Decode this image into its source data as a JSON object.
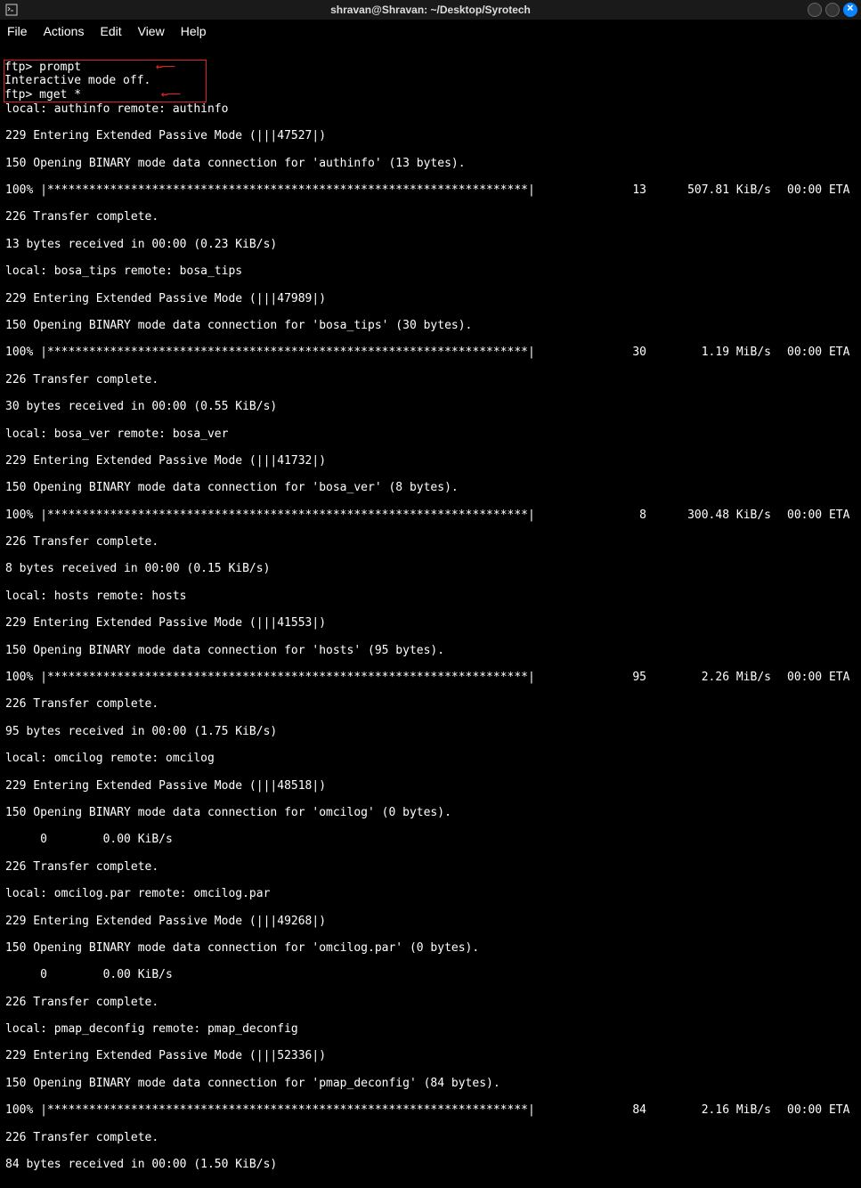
{
  "window": {
    "title": "shravan@Shravan: ~/Desktop/Syrotech"
  },
  "menu": {
    "file": "File",
    "actions": "Actions",
    "edit": "Edit",
    "view": "View",
    "help": "Help"
  },
  "box": {
    "line1": "ftp> prompt",
    "line2": "Interactive mode off.",
    "line3": "ftp> mget *"
  },
  "lines": {
    "l0": "local: authinfo remote: authinfo",
    "l1": "229 Entering Extended Passive Mode (|||47527|)",
    "l2": "150 Opening BINARY mode data connection for 'authinfo' (13 bytes).",
    "l3a": "100% |*********************************************************************|",
    "l3b": "13",
    "l3c": "507.81 KiB/s",
    "l3d": "00:00 ETA",
    "l4": "226 Transfer complete.",
    "l5": "13 bytes received in 00:00 (0.23 KiB/s)",
    "l6": "local: bosa_tips remote: bosa_tips",
    "l7": "229 Entering Extended Passive Mode (|||47989|)",
    "l8": "150 Opening BINARY mode data connection for 'bosa_tips' (30 bytes).",
    "l9a": "100% |*********************************************************************|",
    "l9b": "30",
    "l9c": "1.19 MiB/s",
    "l9d": "00:00 ETA",
    "l10": "226 Transfer complete.",
    "l11": "30 bytes received in 00:00 (0.55 KiB/s)",
    "l12": "local: bosa_ver remote: bosa_ver",
    "l13": "229 Entering Extended Passive Mode (|||41732|)",
    "l14": "150 Opening BINARY mode data connection for 'bosa_ver' (8 bytes).",
    "l15a": "100% |*********************************************************************|",
    "l15b": "8",
    "l15c": "300.48 KiB/s",
    "l15d": "00:00 ETA",
    "l16": "226 Transfer complete.",
    "l17": "8 bytes received in 00:00 (0.15 KiB/s)",
    "l18": "local: hosts remote: hosts",
    "l19": "229 Entering Extended Passive Mode (|||41553|)",
    "l20": "150 Opening BINARY mode data connection for 'hosts' (95 bytes).",
    "l21a": "100% |*********************************************************************|",
    "l21b": "95",
    "l21c": "2.26 MiB/s",
    "l21d": "00:00 ETA",
    "l22": "226 Transfer complete.",
    "l23": "95 bytes received in 00:00 (1.75 KiB/s)",
    "l24": "local: omcilog remote: omcilog",
    "l25": "229 Entering Extended Passive Mode (|||48518|)",
    "l26": "150 Opening BINARY mode data connection for 'omcilog' (0 bytes).",
    "l27": "     0        0.00 KiB/s ",
    "l28": "226 Transfer complete.",
    "l29": "local: omcilog.par remote: omcilog.par",
    "l30": "229 Entering Extended Passive Mode (|||49268|)",
    "l31": "150 Opening BINARY mode data connection for 'omcilog.par' (0 bytes).",
    "l32": "     0        0.00 KiB/s ",
    "l33": "226 Transfer complete.",
    "l34": "local: pmap_deconfig remote: pmap_deconfig",
    "l35": "229 Entering Extended Passive Mode (|||52336|)",
    "l36": "150 Opening BINARY mode data connection for 'pmap_deconfig' (84 bytes).",
    "l37a": "100% |*********************************************************************|",
    "l37b": "84",
    "l37c": "2.16 MiB/s",
    "l37d": "00:00 ETA",
    "l38": "226 Transfer complete.",
    "l39": "84 bytes received in 00:00 (1.50 KiB/s)"
  }
}
